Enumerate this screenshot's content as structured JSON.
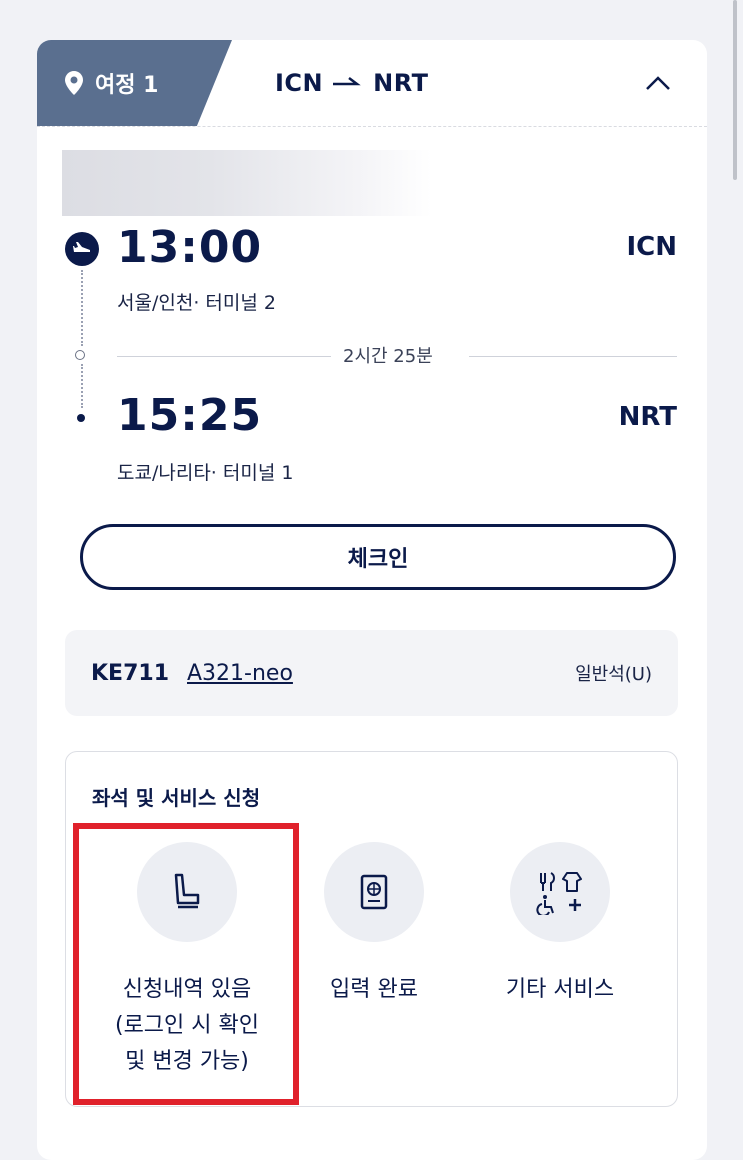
{
  "leg": {
    "label": "여정 1",
    "origin": "ICN",
    "destination": "NRT"
  },
  "departure": {
    "time": "13:00",
    "code": "ICN",
    "place": "서울/인천· 터미널  2"
  },
  "duration": "2시간 25분",
  "arrival": {
    "time": "15:25",
    "code": "NRT",
    "place": "도쿄/나리타· 터미널  1"
  },
  "checkin_label": "체크인",
  "flight": {
    "number": "KE711",
    "aircraft": "A321-neo",
    "cabin": "일반석(U)"
  },
  "services": {
    "title": "좌석 및 서비스 신청",
    "items": [
      {
        "label": "신청내역 있음\n(로그인 시 확인\n및 변경 가능)",
        "icon": "seat-icon"
      },
      {
        "label": "입력 완료",
        "icon": "passport-icon"
      },
      {
        "label": "기타 서비스",
        "icon": "other-services-icon"
      }
    ]
  },
  "colors": {
    "navy": "#0b1a4a",
    "tab": "#5a6f8f",
    "highlight": "#e0212b"
  }
}
